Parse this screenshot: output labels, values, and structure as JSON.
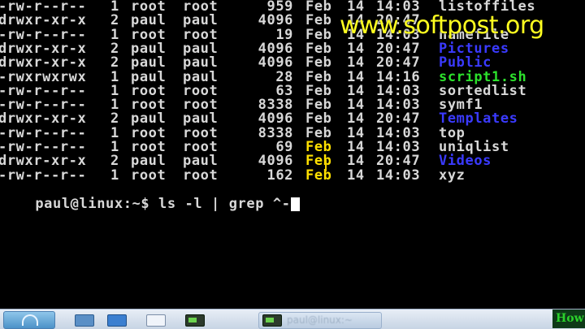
{
  "watermark": "www.softpost.org",
  "listing": [
    {
      "perm": "-rw-r--r--",
      "links": "1",
      "user": "root",
      "group": "root",
      "size": "959",
      "month": "Feb",
      "day": "14",
      "time": "14:03",
      "name": "listoffiles",
      "kind": "file"
    },
    {
      "perm": "drwxr-xr-x",
      "links": "2",
      "user": "paul",
      "group": "paul",
      "size": "4096",
      "month": "Feb",
      "day": "14",
      "time": "20:47",
      "name": "",
      "kind": "dir"
    },
    {
      "perm": "-rw-r--r--",
      "links": "1",
      "user": "root",
      "group": "root",
      "size": "19",
      "month": "Feb",
      "day": "14",
      "time": "14:03",
      "name": "namefile",
      "kind": "file"
    },
    {
      "perm": "drwxr-xr-x",
      "links": "2",
      "user": "paul",
      "group": "paul",
      "size": "4096",
      "month": "Feb",
      "day": "14",
      "time": "20:47",
      "name": "Pictures",
      "kind": "dir"
    },
    {
      "perm": "drwxr-xr-x",
      "links": "2",
      "user": "paul",
      "group": "paul",
      "size": "4096",
      "month": "Feb",
      "day": "14",
      "time": "20:47",
      "name": "Public",
      "kind": "dir"
    },
    {
      "perm": "-rwxrwxrwx",
      "links": "1",
      "user": "paul",
      "group": "paul",
      "size": "28",
      "month": "Feb",
      "day": "14",
      "time": "14:16",
      "name": "script1.sh",
      "kind": "exec"
    },
    {
      "perm": "-rw-r--r--",
      "links": "1",
      "user": "root",
      "group": "root",
      "size": "63",
      "month": "Feb",
      "day": "14",
      "time": "14:03",
      "name": "sortedlist",
      "kind": "file"
    },
    {
      "perm": "-rw-r--r--",
      "links": "1",
      "user": "root",
      "group": "root",
      "size": "8338",
      "month": "Feb",
      "day": "14",
      "time": "14:03",
      "name": "symf1",
      "kind": "file"
    },
    {
      "perm": "drwxr-xr-x",
      "links": "2",
      "user": "paul",
      "group": "paul",
      "size": "4096",
      "month": "Feb",
      "day": "14",
      "time": "20:47",
      "name": "Templates",
      "kind": "dir"
    },
    {
      "perm": "-rw-r--r--",
      "links": "1",
      "user": "root",
      "group": "root",
      "size": "8338",
      "month": "Feb",
      "day": "14",
      "time": "14:03",
      "name": "top",
      "kind": "file"
    },
    {
      "perm": "-rw-r--r--",
      "links": "1",
      "user": "root",
      "group": "root",
      "size": "69",
      "month": "Feb",
      "day": "14",
      "time": "14:03",
      "name": "uniqlist",
      "kind": "file",
      "month_highlight": true
    },
    {
      "perm": "drwxr-xr-x",
      "links": "2",
      "user": "paul",
      "group": "paul",
      "size": "4096",
      "month": "Feb",
      "day": "14",
      "time": "20:47",
      "name": "Videos",
      "kind": "dir",
      "month_highlight": true
    },
    {
      "perm": "-rw-r--r--",
      "links": "1",
      "user": "root",
      "group": "root",
      "size": "162",
      "month": "Feb",
      "day": "14",
      "time": "14:03",
      "name": "xyz",
      "kind": "file",
      "month_highlight": true
    }
  ],
  "prompt": {
    "text": "paul@linux:~$ ",
    "command": "ls -l | grep ^-"
  },
  "taskbar": {
    "task_label": "paul@linux:~",
    "corner_text": "How"
  },
  "colors": {
    "dir": "#3a3aff",
    "exec": "#2ce12c",
    "file": "#d8d8d8",
    "watermark": "#ffff20",
    "highlight": "#ffe100"
  }
}
